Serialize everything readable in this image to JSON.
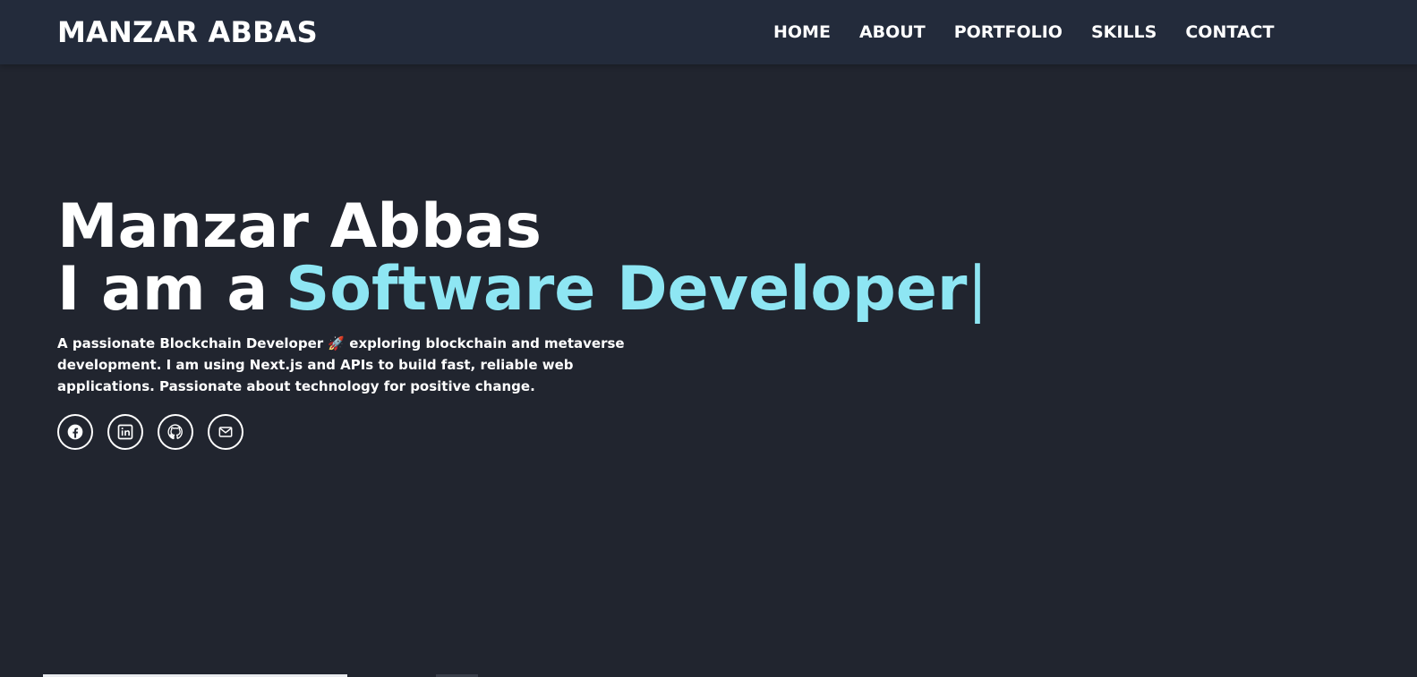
{
  "navbar": {
    "brand": "MANZAR ABBAS",
    "links": [
      {
        "label": "HOME"
      },
      {
        "label": "ABOUT"
      },
      {
        "label": "PORTFOLIO"
      },
      {
        "label": "SKILLS"
      },
      {
        "label": "CONTACT"
      }
    ]
  },
  "hero": {
    "name": "Manzar Abbas",
    "role_prefix": "I am a",
    "role_typed": "Software Developer",
    "cursor": "|",
    "description": "A passionate Blockchain Developer 🚀 exploring blockchain and metaverse development. I am using Next.js and APIs to build fast, reliable web applications. Passionate about technology for positive change.",
    "socials": [
      {
        "icon": "facebook-icon"
      },
      {
        "icon": "linkedin-icon"
      },
      {
        "icon": "github-icon"
      },
      {
        "icon": "mail-icon"
      }
    ]
  },
  "colors": {
    "background": "#21252f",
    "navbar": "#232b3b",
    "accent": "#8ee6f3",
    "text": "#ffffff"
  }
}
